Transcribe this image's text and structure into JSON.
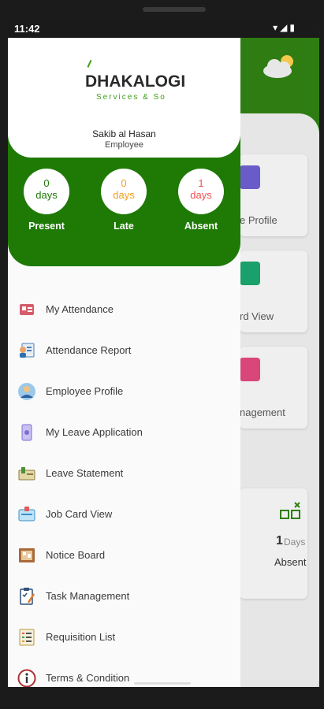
{
  "status_bar": {
    "time": "11:42",
    "icons": "▾◢▮"
  },
  "app": {
    "logo_text_main": "DHAKALOGI",
    "logo_text_sub": "Services & So",
    "user_name": "Sakib al Hasan",
    "user_role": "Employee",
    "stats": [
      {
        "value": "0",
        "unit": "days",
        "label": "Present",
        "color": "#1e7a05"
      },
      {
        "value": "0",
        "unit": "days",
        "label": "Late",
        "color": "#f0a019"
      },
      {
        "value": "1",
        "unit": "days",
        "label": "Absent",
        "color": "#f05050"
      }
    ]
  },
  "menu": [
    {
      "label": "My Attendance",
      "icon": "attendance-icon"
    },
    {
      "label": "Attendance Report",
      "icon": "report-icon"
    },
    {
      "label": "Employee Profile",
      "icon": "profile-icon"
    },
    {
      "label": "My Leave Application",
      "icon": "leave-app-icon"
    },
    {
      "label": "Leave Statement",
      "icon": "statement-icon"
    },
    {
      "label": "Job Card View",
      "icon": "job-card-icon"
    },
    {
      "label": "Notice Board",
      "icon": "notice-board-icon"
    },
    {
      "label": "Task Management",
      "icon": "task-icon"
    },
    {
      "label": "Requisition List",
      "icon": "requisition-icon"
    },
    {
      "label": "Terms & Condition",
      "icon": "info-icon"
    }
  ],
  "background": {
    "card_labels": [
      "e Profile",
      "rd View",
      "nagement"
    ],
    "absent_value": "1",
    "absent_unit": "Days",
    "absent_label": "Absent"
  }
}
